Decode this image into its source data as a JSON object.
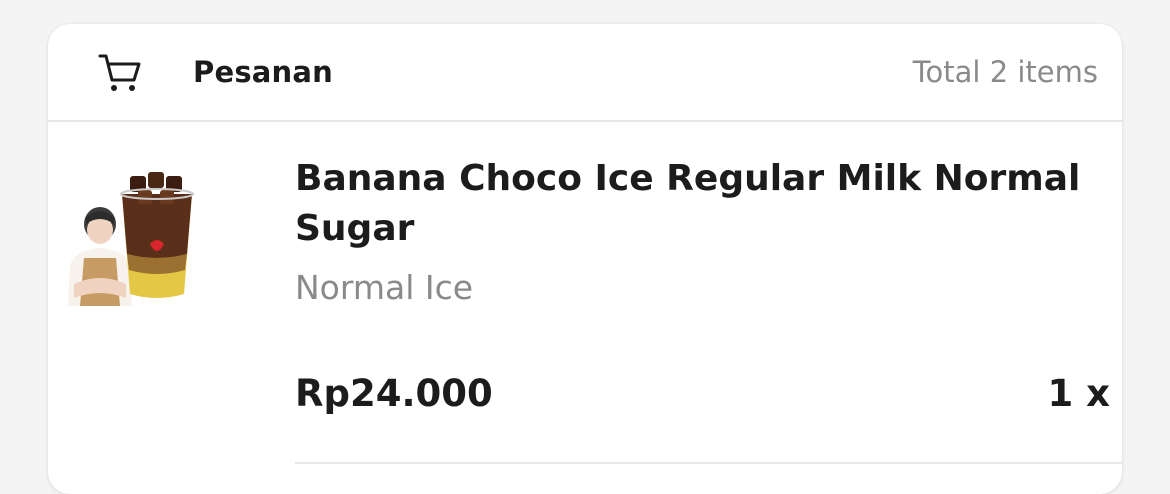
{
  "order": {
    "title": "Pesanan",
    "total_label": "Total 2 items",
    "cart_icon": "cart-icon"
  },
  "items": [
    {
      "name": "Banana Choco Ice Regular Milk Normal Sugar",
      "variant": "Normal Ice",
      "price": "Rp24.000",
      "quantity": "1 x",
      "image_icon": "product-photo"
    }
  ]
}
